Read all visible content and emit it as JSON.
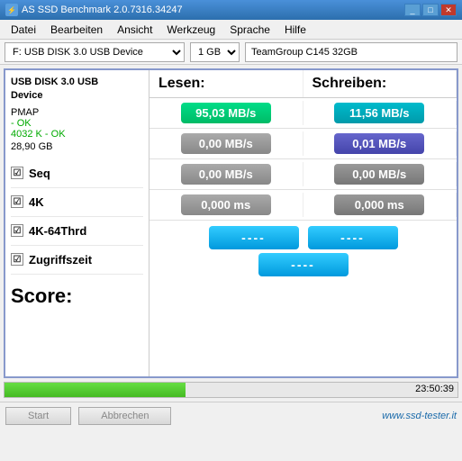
{
  "titleBar": {
    "title": "AS SSD Benchmark 2.0.7316.34247",
    "minLabel": "_",
    "maxLabel": "□",
    "closeLabel": "✕"
  },
  "menuBar": {
    "items": [
      "Datei",
      "Bearbeiten",
      "Ansicht",
      "Werkzeug",
      "Sprache",
      "Hilfe"
    ]
  },
  "toolbar": {
    "drivePath": "F: USB DISK 3.0 USB Device",
    "size": "1 GB",
    "driveName": "TeamGroup C145 32GB"
  },
  "leftPanel": {
    "deviceLine1": "USB DISK 3.0 USB",
    "deviceLine2": "Device",
    "pmapLabel": "PMAP",
    "status1": "- OK",
    "status2": "4032 K - OK",
    "sizeInfo": "28,90 GB"
  },
  "columns": {
    "read": "Lesen:",
    "write": "Schreiben:"
  },
  "rows": [
    {
      "label": "Seq",
      "readValue": "95,03 MB/s",
      "readClass": "green-box",
      "writeValue": "11,56 MB/s",
      "writeClass": "teal-box"
    },
    {
      "label": "4K",
      "readValue": "0,00 MB/s",
      "readClass": "gray-box",
      "writeValue": "0,01 MB/s",
      "writeClass": "purple-box"
    },
    {
      "label": "4K-64Thrd",
      "readValue": "0,00 MB/s",
      "readClass": "gray-box",
      "writeValue": "0,00 MB/s",
      "writeClass": "dark-gray-box"
    },
    {
      "label": "Zugriffszeit",
      "readValue": "0,000 ms",
      "readClass": "gray-box",
      "writeValue": "0,000 ms",
      "writeClass": "dark-gray-box"
    }
  ],
  "score": {
    "label": "Score:",
    "readScore": "----",
    "writeScore": "----",
    "totalScore": "----"
  },
  "progress": {
    "fillPercent": 40,
    "time": "23:50:39"
  },
  "buttons": {
    "start": "Start",
    "cancel": "Abbrechen"
  },
  "website": "www.ssd-tester.it",
  "checkmark": "☑"
}
